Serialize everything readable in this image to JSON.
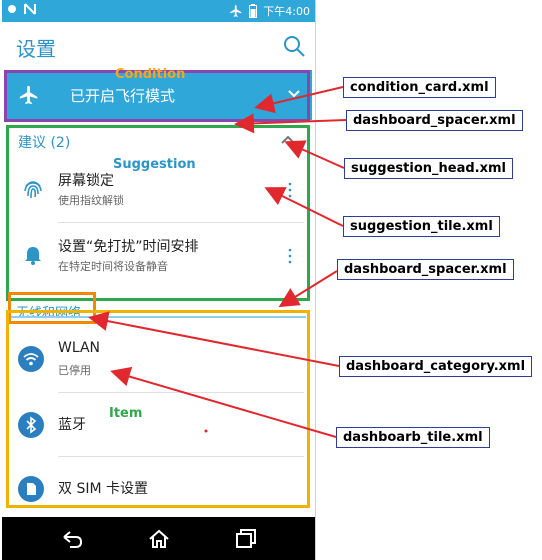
{
  "status_bar": {
    "time": "下午4:00"
  },
  "app_bar": {
    "title": "设置"
  },
  "condition": {
    "text": "已开启飞行模式",
    "overlay_label": "Condition"
  },
  "suggestion": {
    "header": "建议 (2)",
    "overlay_label": "Suggestion",
    "tiles": [
      {
        "title": "屏幕锁定",
        "subtitle": "使用指纹解锁"
      },
      {
        "title": "设置“免打扰”时间安排",
        "subtitle": "在特定时间将设备静音"
      }
    ]
  },
  "category": {
    "title": "无线和网络",
    "overlay_label": "Item",
    "items": [
      {
        "title": "WLAN",
        "subtitle": "已停用"
      },
      {
        "title": "蓝牙",
        "subtitle": ""
      },
      {
        "title": "双 SIM 卡设置",
        "subtitle": ""
      }
    ]
  },
  "annotations": {
    "condition_card": "condition_card.xml",
    "dashboard_spacer_1": "dashboard_spacer.xml",
    "suggestion_head": "suggestion_head.xml",
    "suggestion_tile": "suggestion_tile.xml",
    "dashboard_spacer_2": "dashboard_spacer.xml",
    "dashboard_category": "dashboard_category.xml",
    "dashboard_tile": "dashboarb_tile.xml"
  },
  "colors": {
    "accent": "#2fa7d9",
    "annotation_arrow": "#e0282e",
    "condition_box": "#8e44ad",
    "suggestion_box": "#2ea84a",
    "category_box": "#f0b400",
    "category_title_box": "#f08a00",
    "condition_label": "#f5a623",
    "suggestion_label": "#2c94c7",
    "item_label": "#2ea84a"
  }
}
